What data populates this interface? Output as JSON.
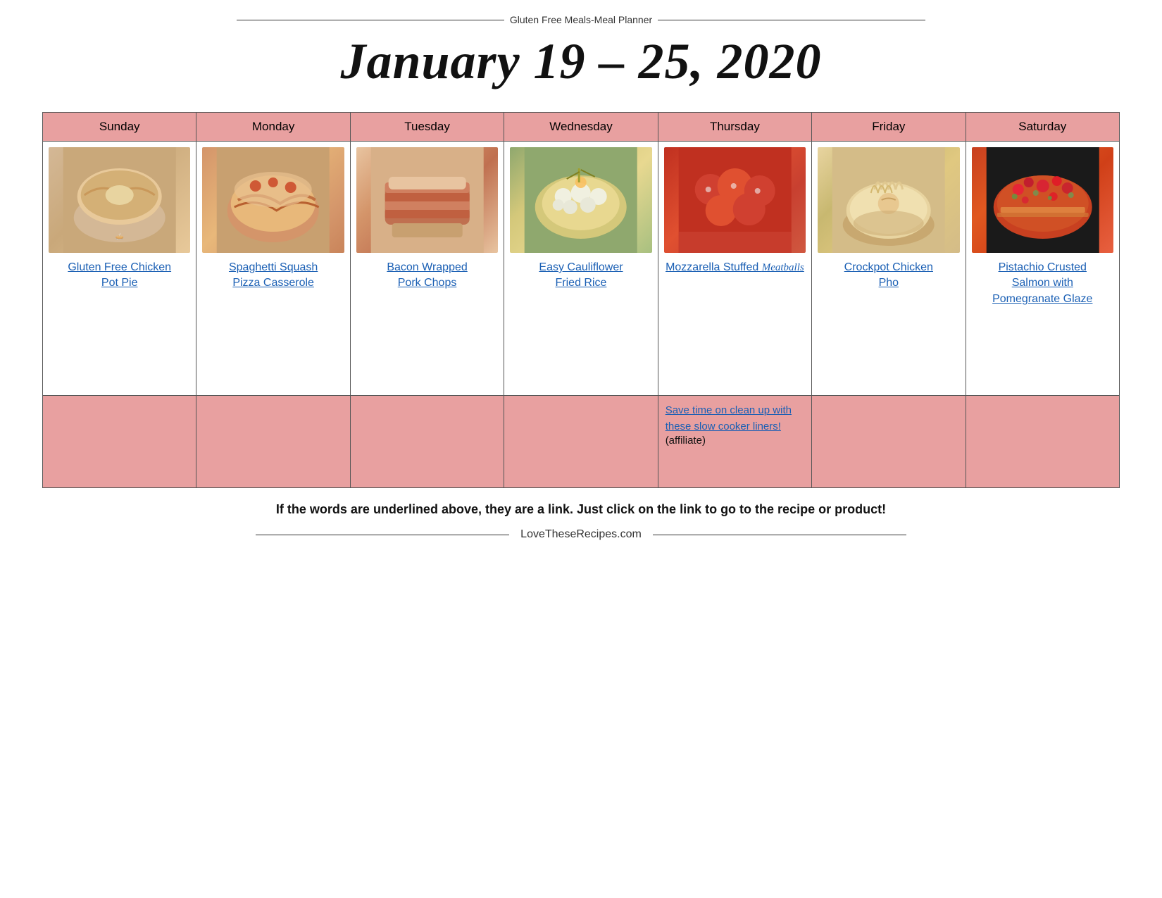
{
  "header": {
    "site_label": "Gluten Free Meals-Meal Planner",
    "title": "January 19 – 25, 2020"
  },
  "days": [
    "Sunday",
    "Monday",
    "Tuesday",
    "Wednesday",
    "Thursday",
    "Friday",
    "Saturday"
  ],
  "meals": [
    {
      "id": "sunday",
      "name": "Gluten Free Chicken Pot Pie",
      "img_class": "img-chicken-pot-pie",
      "cursive": false
    },
    {
      "id": "monday",
      "name": "Spaghetti Squash Pizza Casserole",
      "img_class": "img-spaghetti",
      "cursive": false
    },
    {
      "id": "tuesday",
      "name": "Bacon Wrapped Pork Chops",
      "img_class": "img-bacon-pork",
      "cursive": false
    },
    {
      "id": "wednesday",
      "name": "Easy Cauliflower Fried Rice",
      "img_class": "img-cauliflower",
      "cursive": false
    },
    {
      "id": "thursday",
      "name": "Mozzarella Stuffed Meatballs",
      "img_class": "img-meatballs",
      "cursive": true,
      "cursive_part": "Meatballs",
      "non_cursive_part": "Mozzarella Stuffed "
    },
    {
      "id": "friday",
      "name": "Crockpot Chicken Pho",
      "img_class": "img-pho",
      "cursive": false
    },
    {
      "id": "saturday",
      "name": "Pistachio Crusted Salmon with Pomegranate Glaze",
      "img_class": "img-salmon",
      "cursive": false
    }
  ],
  "affiliate": {
    "text": "Save time on clean up with these slow cooker liners!",
    "suffix": "(affiliate)"
  },
  "footer": {
    "note": "If the words are underlined above, they are a link. Just click on the link to go to the recipe or product!",
    "url": "LoveTheseRecipes.com"
  }
}
